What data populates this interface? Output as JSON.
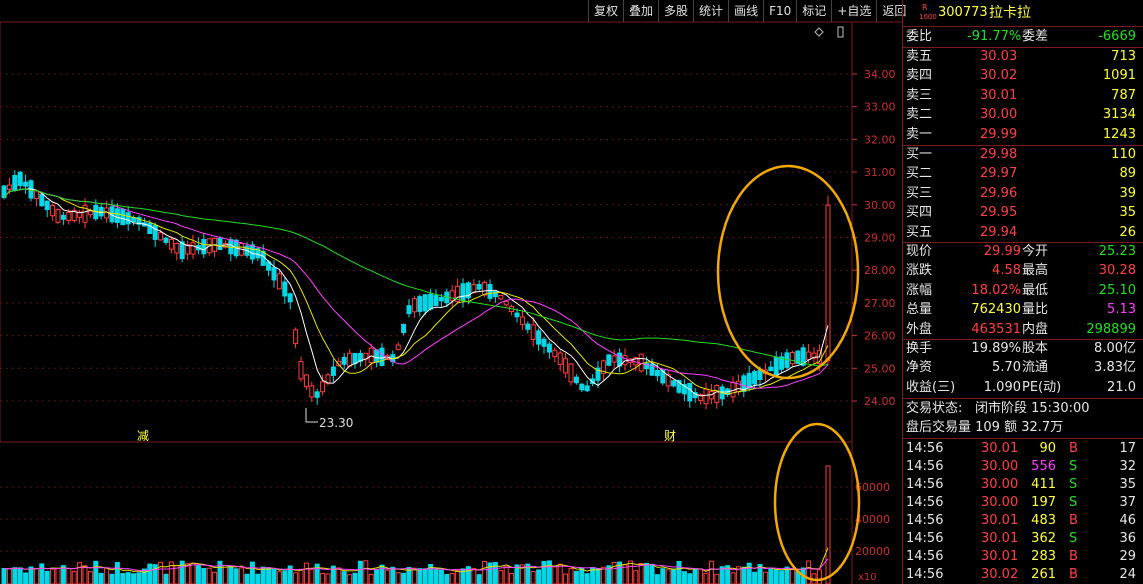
{
  "toolbar": {
    "items": [
      "复权",
      "叠加",
      "多股",
      "统计",
      "画线",
      "F10",
      "标记",
      "+自选",
      "返回"
    ]
  },
  "stock": {
    "badge_top": "R",
    "badge_bottom": "1000",
    "code": "300773",
    "name": "拉卡拉"
  },
  "summary": {
    "weibi_label": "委比",
    "weibi_value": "-91.77%",
    "weicha_label": "委差",
    "weicha_value": "-6669"
  },
  "asks": [
    {
      "label": "卖五",
      "price": "30.03",
      "vol": "713"
    },
    {
      "label": "卖四",
      "price": "30.02",
      "vol": "1091"
    },
    {
      "label": "卖三",
      "price": "30.01",
      "vol": "787"
    },
    {
      "label": "卖二",
      "price": "30.00",
      "vol": "3134"
    },
    {
      "label": "卖一",
      "price": "29.99",
      "vol": "1243"
    }
  ],
  "bids": [
    {
      "label": "买一",
      "price": "29.98",
      "vol": "110"
    },
    {
      "label": "买二",
      "price": "29.97",
      "vol": "89"
    },
    {
      "label": "买三",
      "price": "29.96",
      "vol": "39"
    },
    {
      "label": "买四",
      "price": "29.95",
      "vol": "35"
    },
    {
      "label": "买五",
      "price": "29.94",
      "vol": "26"
    }
  ],
  "quote": [
    {
      "l1": "现价",
      "v1": "29.99",
      "c1": "red",
      "l2": "今开",
      "v2": "25.23",
      "c2": "green"
    },
    {
      "l1": "涨跌",
      "v1": "4.58",
      "c1": "red",
      "l2": "最高",
      "v2": "30.28",
      "c2": "red"
    },
    {
      "l1": "涨幅",
      "v1": "18.02%",
      "c1": "red",
      "l2": "最低",
      "v2": "25.10",
      "c2": "green"
    },
    {
      "l1": "总量",
      "v1": "762430",
      "c1": "yellow",
      "l2": "量比",
      "v2": "5.13",
      "c2": "mag"
    },
    {
      "l1": "外盘",
      "v1": "463531",
      "c1": "red",
      "l2": "内盘",
      "v2": "298899",
      "c2": "green"
    }
  ],
  "fundamentals": [
    {
      "l1": "换手",
      "v1": "19.89%",
      "l2": "股本",
      "v2": "8.00亿"
    },
    {
      "l1": "净资",
      "v1": "5.70",
      "l2": "流通",
      "v2": "3.83亿"
    },
    {
      "l1": "收益(三)",
      "v1": "1.090",
      "l2": "PE(动)",
      "v2": "21.0"
    }
  ],
  "trade_status": {
    "label": "交易状态:",
    "value": "闭市阶段 15:30:00"
  },
  "after_hours": "盘后交易量 109 额 32.7万",
  "ticks": [
    {
      "time": "14:56",
      "price": "30.01",
      "vol": "90",
      "vc": "yellow",
      "side": "B",
      "n": "17"
    },
    {
      "time": "14:56",
      "price": "30.00",
      "vol": "556",
      "vc": "mag",
      "side": "S",
      "n": "32"
    },
    {
      "time": "14:56",
      "price": "30.00",
      "vol": "411",
      "vc": "yellow",
      "side": "S",
      "n": "35"
    },
    {
      "time": "14:56",
      "price": "30.00",
      "vol": "197",
      "vc": "yellow",
      "side": "S",
      "n": "37"
    },
    {
      "time": "14:56",
      "price": "30.01",
      "vol": "483",
      "vc": "yellow",
      "side": "B",
      "n": "46"
    },
    {
      "time": "14:56",
      "price": "30.01",
      "vol": "362",
      "vc": "yellow",
      "side": "S",
      "n": "36"
    },
    {
      "time": "14:56",
      "price": "30.01",
      "vol": "283",
      "vc": "yellow",
      "side": "B",
      "n": "29"
    },
    {
      "time": "14:56",
      "price": "30.02",
      "vol": "261",
      "vc": "yellow",
      "side": "B",
      "n": "24"
    }
  ],
  "chart_data": {
    "type": "candlestick",
    "price_axis": [
      "34.00",
      "33.00",
      "32.00",
      "31.00",
      "30.00",
      "29.00",
      "28.00",
      "27.00",
      "26.00",
      "25.00",
      "24.00"
    ],
    "volume_axis": [
      "60000",
      "40000",
      "20000"
    ],
    "volume_unit": "x10",
    "low_marker": "23.30",
    "event_labels": [
      "减",
      "财"
    ],
    "colors": {
      "up": "#ff3c3c",
      "down": "#00d8e8",
      "ma5": "#ffffff",
      "ma10": "#e6e600",
      "ma20": "#ff40ff",
      "ma60": "#22dd22",
      "highlight": "#f2a900"
    }
  }
}
